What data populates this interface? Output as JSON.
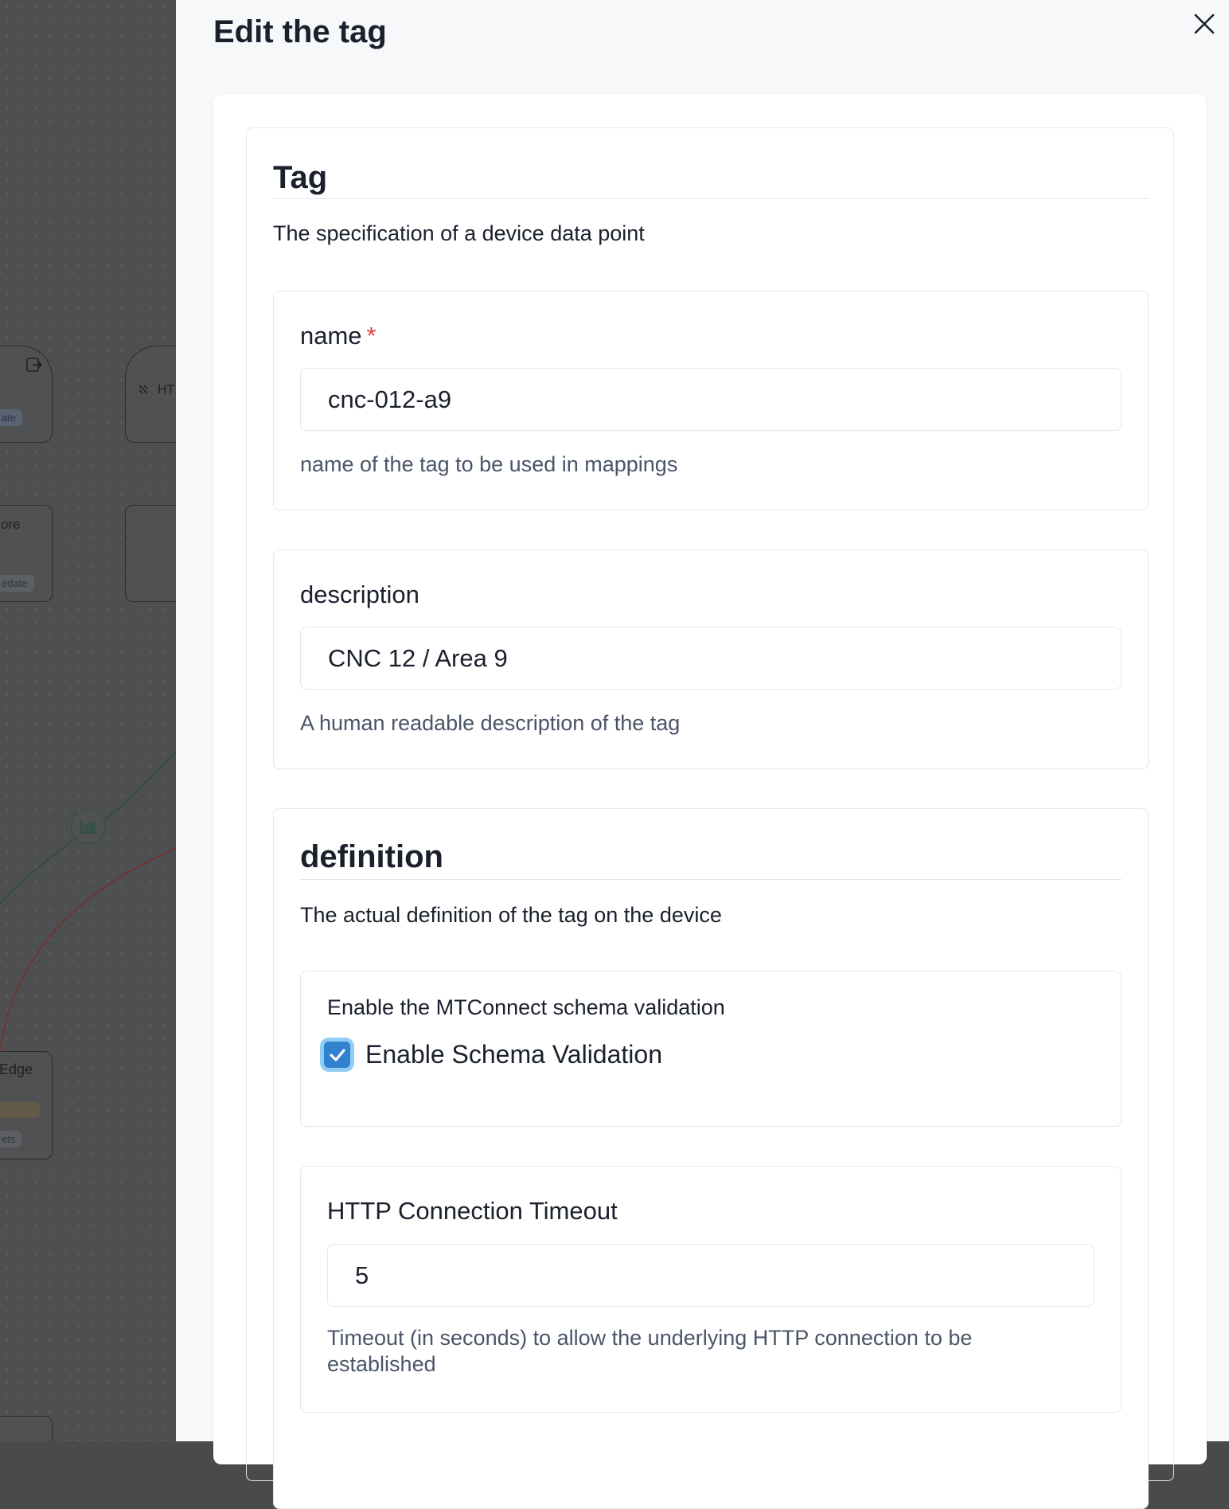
{
  "background": {
    "nodes": [
      {
        "label": ""
      },
      {
        "label": "HT"
      },
      {
        "label": "ore"
      },
      {
        "label": ""
      },
      {
        "label": "Edge"
      },
      {
        "label": ""
      }
    ],
    "badges": [
      "ate",
      "edate",
      "ets"
    ],
    "icons": [
      "export-icon",
      "plug-icon",
      "bar-chart-icon"
    ]
  },
  "drawer": {
    "title": "Edit the tag",
    "close_icon": "close-icon"
  },
  "tag": {
    "heading": "Tag",
    "description": "The specification of a device data point",
    "name": {
      "label": "name",
      "required_mark": "*",
      "value": "cnc-012-a9",
      "helper": "name of the tag to be used in mappings"
    },
    "description_field": {
      "label": "description",
      "value": "CNC 12 / Area 9",
      "helper": "A human readable description of the tag"
    }
  },
  "definition": {
    "heading": "definition",
    "description": "The actual definition of the tag on the device",
    "schema_validation": {
      "label": "Enable the MTConnect schema validation",
      "checkbox_label": "Enable Schema Validation",
      "checked": true
    },
    "timeout": {
      "label": "HTTP Connection Timeout",
      "value": "5",
      "helper": "Timeout (in seconds) to allow the underlying HTTP connection to be established"
    }
  },
  "colors": {
    "accent": "#3182ce",
    "required": "#e53e3e",
    "edge_green": "#2f4f40",
    "edge_red": "#6e3434"
  }
}
